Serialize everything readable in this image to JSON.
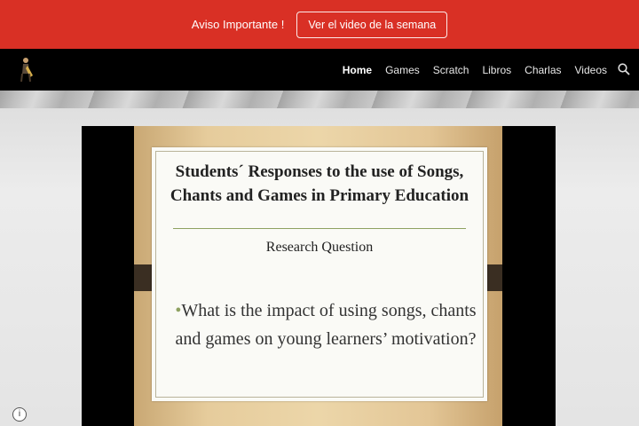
{
  "announcement": {
    "text": "Aviso Importante !",
    "button_label": "Ver el video de la semana",
    "color": "#d93025"
  },
  "nav": {
    "logo_icon": "saxophone-player-logo",
    "items": [
      {
        "label": "Home",
        "active": true
      },
      {
        "label": "Games"
      },
      {
        "label": "Scratch"
      },
      {
        "label": "Libros"
      },
      {
        "label": "Charlas"
      },
      {
        "label": "Videos"
      }
    ],
    "search_icon": "search-icon"
  },
  "video": {
    "slide": {
      "title_line1": "Students´ Responses to the use of Songs,",
      "title_line2": "Chants and Games in Primary Education",
      "subtitle": "Research Question",
      "bullet_line1": "What is the impact of  using songs, chants",
      "bullet_line2": "and games on young learners’ motivation?"
    }
  },
  "info_icon": {
    "glyph": "i"
  }
}
